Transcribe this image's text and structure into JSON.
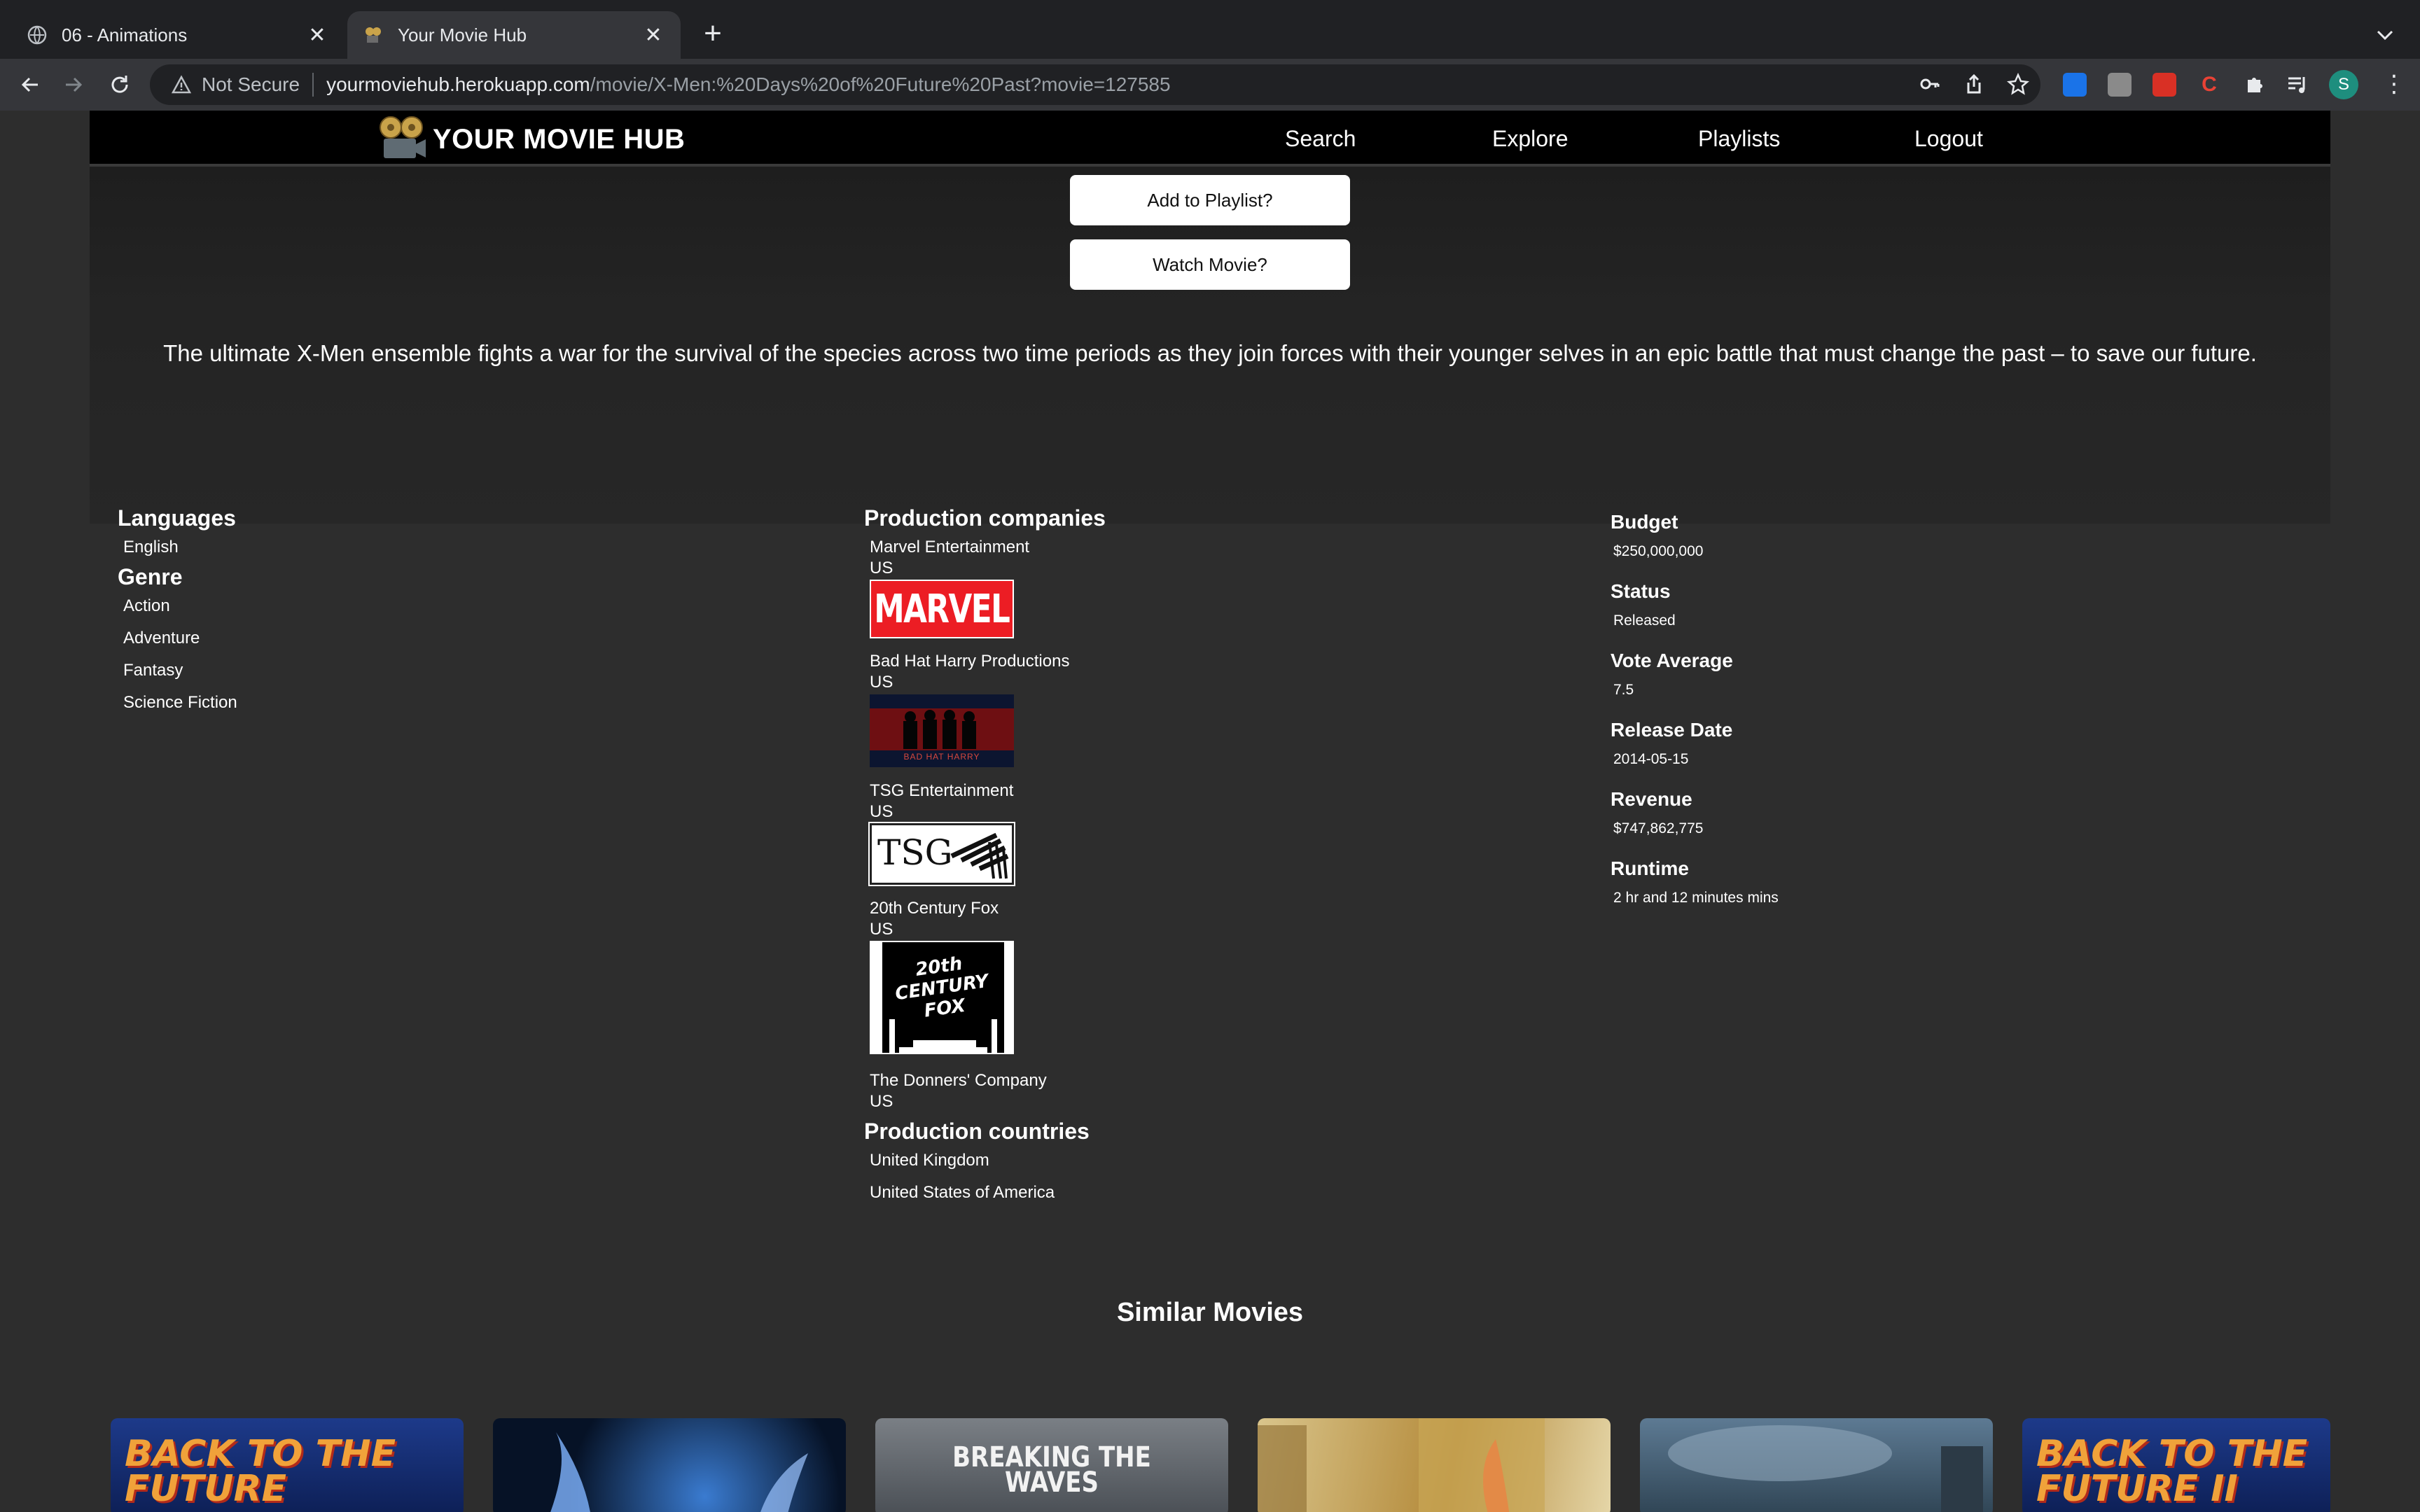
{
  "browser": {
    "tabs": [
      {
        "title": "06 - Animations",
        "active": false
      },
      {
        "title": "Your Movie Hub",
        "active": true
      }
    ],
    "address": {
      "security_label": "Not Secure",
      "host": "yourmoviehub.herokuapp.com",
      "path": "/movie/X-Men:%20Days%20of%20Future%20Past?movie=127585"
    },
    "profile_initial": "S"
  },
  "site": {
    "brand": "YOUR MOVIE HUB",
    "nav": [
      "Search",
      "Explore",
      "Playlists",
      "Logout"
    ]
  },
  "actions": {
    "add_to_playlist": "Add to Playlist?",
    "watch_movie": "Watch Movie?"
  },
  "overview": "The ultimate X-Men ensemble fights a war for the survival of the species across two time periods as they join forces with their younger selves in an epic battle that must change the past – to save our future.",
  "languages": {
    "heading": "Languages",
    "items": [
      "English"
    ]
  },
  "genre": {
    "heading": "Genre",
    "items": [
      "Action",
      "Adventure",
      "Fantasy",
      "Science Fiction"
    ]
  },
  "production_companies": {
    "heading": "Production companies",
    "items": [
      {
        "name": "Marvel Entertainment",
        "country": "US",
        "logo_text": "MARVEL"
      },
      {
        "name": "Bad Hat Harry Productions",
        "country": "US",
        "logo_text": "BAD HAT HARRY"
      },
      {
        "name": "TSG Entertainment",
        "country": "US",
        "logo_text": "TSG"
      },
      {
        "name": "20th Century Fox",
        "country": "US",
        "logo_text": "20th CENTURY FOX"
      },
      {
        "name": "The Donners' Company",
        "country": "US"
      }
    ]
  },
  "production_countries": {
    "heading": "Production countries",
    "items": [
      "United Kingdom",
      "United States of America"
    ]
  },
  "stats": [
    {
      "label": "Budget",
      "value": "$250,000,000"
    },
    {
      "label": "Status",
      "value": "Released"
    },
    {
      "label": "Vote Average",
      "value": "7.5"
    },
    {
      "label": "Release Date",
      "value": "2014-05-15"
    },
    {
      "label": "Revenue",
      "value": "$747,862,775"
    },
    {
      "label": "Runtime",
      "value": "2 hr and 12 minutes mins"
    }
  ],
  "similar": {
    "heading": "Similar Movies",
    "posters": [
      {
        "text": "BACK TO THE FUTURE"
      },
      {
        "text": ""
      },
      {
        "text": "BREAKING THE WAVES"
      },
      {
        "text": ""
      },
      {
        "text": ""
      },
      {
        "text": "BACK TO THE FUTURE II"
      }
    ]
  }
}
